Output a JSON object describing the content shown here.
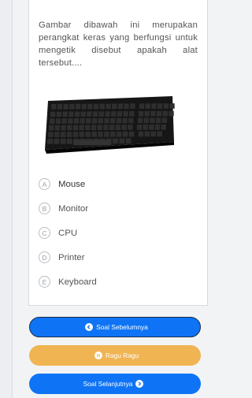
{
  "question": {
    "text": "Gambar dibawah ini merupakan perangkat keras yang berfungsi untuk mengetik disebut apakah alat tersebut...."
  },
  "options": [
    {
      "letter": "A",
      "label": "Mouse"
    },
    {
      "letter": "B",
      "label": "Monitor"
    },
    {
      "letter": "C",
      "label": "CPU"
    },
    {
      "letter": "D",
      "label": "Printer"
    },
    {
      "letter": "E",
      "label": "Keyboard"
    }
  ],
  "buttons": {
    "prev_label": "Soal Sebelumnya",
    "ragu_label": "Ragu Ragu",
    "next_label": "Soal Selanjutnya"
  },
  "colors": {
    "primary": "#0e74f5",
    "warning": "#f0b452",
    "prev_border": "#1a2c4a"
  }
}
